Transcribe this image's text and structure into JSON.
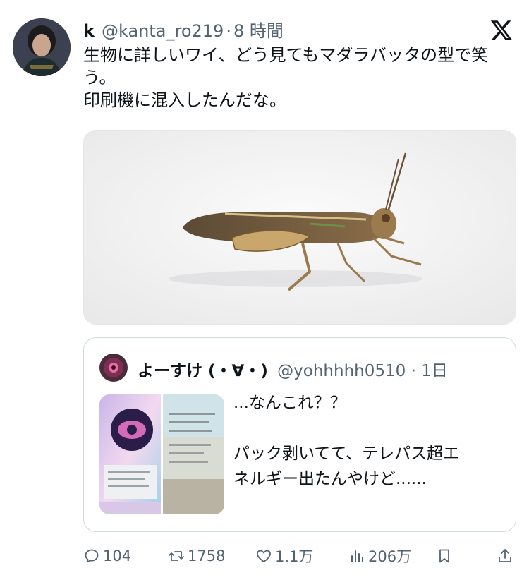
{
  "tweet": {
    "display_name": "k",
    "handle": "@kanta_ro219",
    "separator": "·",
    "time": "8 時間",
    "text_lines": [
      "生物に詳しいワイ、どう見てもマダラバッタの型で笑う。",
      "印刷機に混入したんだな。"
    ]
  },
  "quoted_tweet": {
    "display_name": "よーすけ (・∀・)",
    "handle": "@yohhhhh0510",
    "separator": "·",
    "time": "1日",
    "text_lines": [
      "...なんこれ？？",
      "",
      "パック剥いてて、テレパス超エ",
      "ネルギー出たんやけど......"
    ]
  },
  "actions": {
    "replies": "104",
    "retweets": "1758",
    "likes": "1.1万",
    "views": "206万"
  },
  "icons": {
    "logo": "x-logo-icon",
    "reply": "reply-icon",
    "retweet": "retweet-icon",
    "like": "heart-icon",
    "views": "views-icon",
    "bookmark": "bookmark-icon",
    "share": "share-icon"
  },
  "colors": {
    "text": "#0f1419",
    "secondary": "#536471",
    "border": "#cfd9de"
  }
}
